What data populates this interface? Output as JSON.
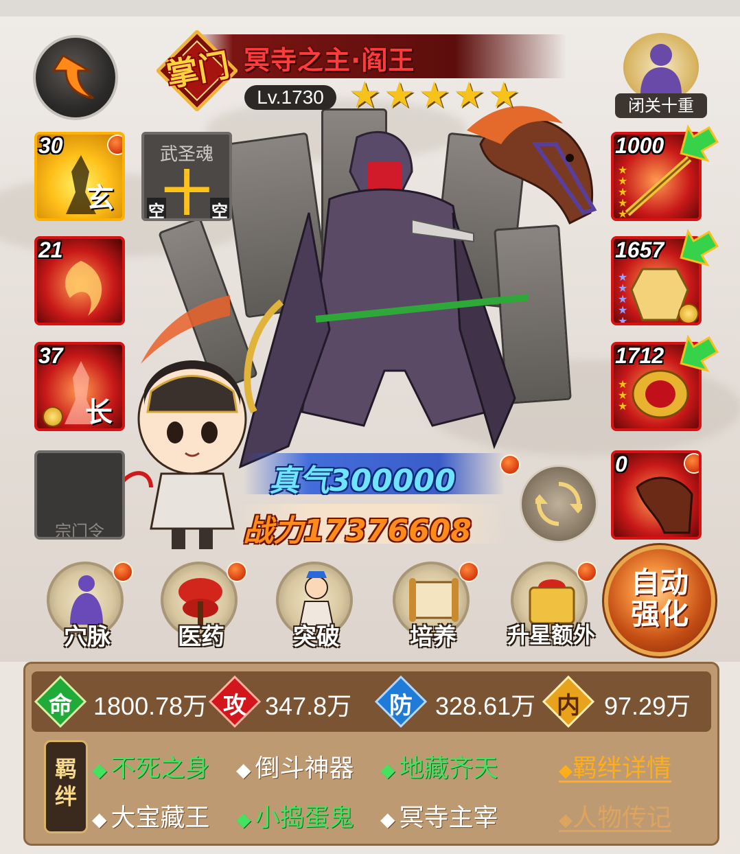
{
  "hero": {
    "rank": "掌门",
    "name": "冥寺之主·阎王",
    "level": "Lv.1730",
    "stars": 5,
    "star_colors": [
      "#f7c21a",
      "#f7c21a",
      "#f7c21a",
      "#f7c21a",
      "#f7c21a"
    ]
  },
  "meditation": {
    "label": "闭关十重",
    "icon": "meditating-monk-icon"
  },
  "left_slots": [
    {
      "count": "30",
      "char": "玄",
      "type": "gold"
    },
    {
      "title": "武圣魂",
      "center": "十",
      "left_corner": "空",
      "right_corner": "空",
      "type": "gray"
    },
    {
      "count": "21",
      "type": "red"
    },
    {
      "count": "37",
      "char": "长",
      "type": "red"
    },
    {
      "label": "宗门令",
      "type": "empty"
    }
  ],
  "equipment": [
    {
      "level": "1000",
      "item": "spear-icon"
    },
    {
      "level": "1657",
      "item": "armor-icon"
    },
    {
      "level": "1712",
      "item": "amulet-icon"
    },
    {
      "level": "0",
      "item": "horse-icon"
    }
  ],
  "zhenqi": "真气300000",
  "power": "战力17376608",
  "menu": [
    {
      "label": "穴脉",
      "icon": "meridian-icon"
    },
    {
      "label": "医药",
      "icon": "herb-icon"
    },
    {
      "label": "突破",
      "icon": "breakthrough-icon"
    },
    {
      "label": "培养",
      "icon": "scroll-icon"
    },
    {
      "label": "升星额外",
      "icon": "star-upgrade-icon"
    }
  ],
  "auto_button": {
    "line1": "自动",
    "line2": "强化"
  },
  "stats": [
    {
      "icon": "命",
      "value": "1800.78万",
      "color": "#1faa3a"
    },
    {
      "icon": "攻",
      "value": "347.8万",
      "color": "#d2161c"
    },
    {
      "icon": "防",
      "value": "328.61万",
      "color": "#1f7ad8"
    },
    {
      "icon": "内",
      "value": "97.29万",
      "color": "#e8a21c"
    }
  ],
  "bond_label": {
    "line1": "羁",
    "line2": "绊"
  },
  "bonds_row1": [
    {
      "text": "不死之身",
      "active": true
    },
    {
      "text": "倒斗神器",
      "active": false
    },
    {
      "text": "地藏齐天",
      "active": true
    }
  ],
  "bonds_row2": [
    {
      "text": "大宝藏王",
      "active": false
    },
    {
      "text": "小捣蛋鬼",
      "active": true
    },
    {
      "text": "冥寺主宰",
      "active": false
    }
  ],
  "links": {
    "details": "羁绊详情",
    "bio": "人物传记"
  }
}
